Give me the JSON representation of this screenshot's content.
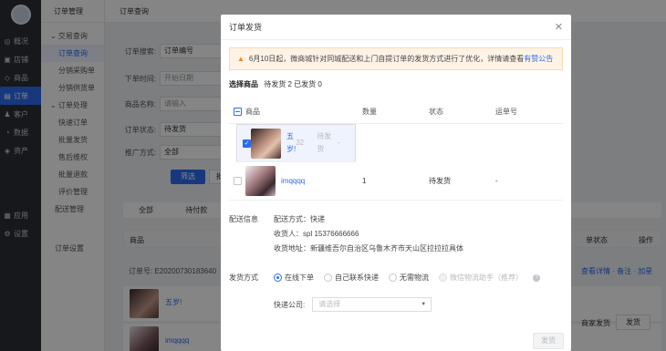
{
  "sidebar": {
    "items": [
      {
        "icon": "eye-icon",
        "glyph": "◎",
        "label": "概况"
      },
      {
        "icon": "store-icon",
        "glyph": "▣",
        "label": "店铺"
      },
      {
        "icon": "goods-icon",
        "glyph": "◇",
        "label": "商品"
      },
      {
        "icon": "order-icon",
        "glyph": "▤",
        "label": "订单"
      },
      {
        "icon": "customer-icon",
        "glyph": "♟",
        "label": "客户"
      },
      {
        "icon": "data-icon",
        "glyph": "◔",
        "label": "数据"
      },
      {
        "icon": "asset-icon",
        "glyph": "◈",
        "label": "资产"
      }
    ],
    "bottom": [
      {
        "icon": "apps-icon",
        "glyph": "▦",
        "label": "应用"
      },
      {
        "icon": "settings-icon",
        "glyph": "⚙",
        "label": "设置"
      }
    ]
  },
  "submenu": {
    "title": "订单管理",
    "group1": "⌄ 交易查询",
    "links1": [
      "订单查询",
      "分销采购单",
      "分销供货单"
    ],
    "group2": "⌄ 订单处理",
    "links2": [
      "快速订单",
      "批量发货",
      "售后维权",
      "批量退款",
      "评价管理"
    ],
    "single": "配送管理",
    "settings": "订单设置"
  },
  "main": {
    "title": "订单查询",
    "search_label": "订单搜索:",
    "search_value": "订单编号",
    "time_label": "下单时间:",
    "time_placeholder": "开始日期",
    "goods_label": "商品名称:",
    "goods_placeholder": "请输入",
    "status_label": "订单状态:",
    "status_value": "待发货",
    "promo_label": "推广方式:",
    "promo_value": "全部",
    "filter_button": "筛选",
    "export_button": "批",
    "tab_all": "全部",
    "tab_unpaid": "待付款",
    "col_goods": "商品",
    "col_status": "单状态",
    "col_ops": "操作",
    "order_no": "订单号: E20200730183640",
    "order_links": "查看详情 · 备注 · 加星",
    "row1_name": "五岁!",
    "row2_name": "imqqqq",
    "row2_status": "商家发货",
    "ship_button": "发货"
  },
  "dialog": {
    "title": "订单发货",
    "close": "✕",
    "notice_text": "6月10日起，微商城针对同城配送和上门自提订单的发货方式进行了优化，详情请查看",
    "notice_link": "有赞公告",
    "select_label": "选择商品",
    "select_counts": "待发货 2  已发货 0",
    "columns": [
      "商品",
      "数量",
      "状态",
      "运单号"
    ],
    "rows": [
      {
        "name": "五岁!",
        "qty": "32",
        "status": "待发货",
        "track": "-",
        "checked": true
      },
      {
        "name": "imqqqq",
        "qty": "1",
        "status": "待发货",
        "track": "-",
        "checked": false
      }
    ],
    "delivery_label": "配送信息",
    "delivery_method": "配送方式：快递",
    "receiver": "收货人：spl 15376666666",
    "address": "收货地址：新疆维吾尔自治区乌鲁木齐市天山区拉拉拉具体",
    "method_label": "发货方式",
    "options": [
      {
        "label": "在线下单",
        "state": "on"
      },
      {
        "label": "自己联系快递",
        "state": "off"
      },
      {
        "label": "无需物流",
        "state": "off"
      },
      {
        "label": "微信物流助手（推荐）",
        "state": "dis"
      }
    ],
    "help": "?",
    "courier_label": "快递公司:",
    "courier_placeholder": "请选择",
    "confirm": "发货"
  }
}
